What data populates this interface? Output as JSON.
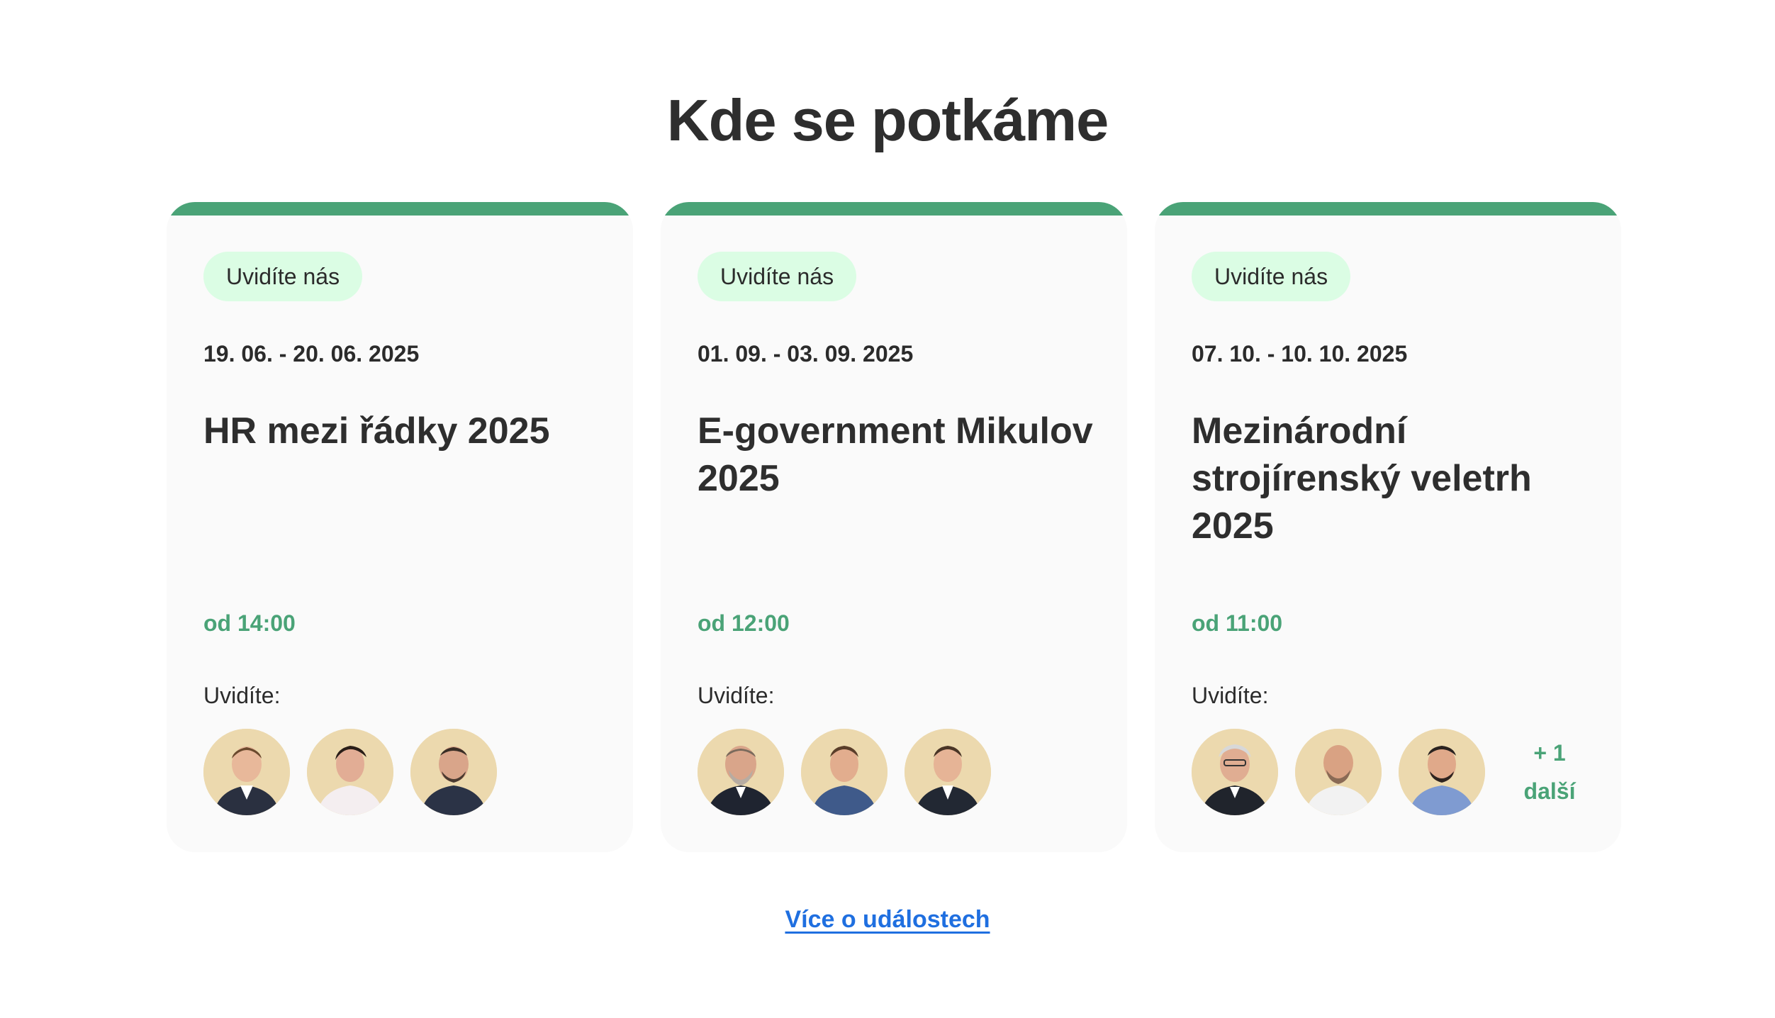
{
  "section": {
    "title": "Kde se potkáme",
    "more_link": "Více o událostech"
  },
  "colors": {
    "accent_green": "#4aa377",
    "badge_bg": "#dbfde4",
    "card_bg": "#fafafa",
    "link_blue": "#1f6fe0",
    "avatar_bg": "#ecd9ae"
  },
  "events": [
    {
      "badge": "Uvidíte nás",
      "date": "19. 06. - 20. 06. 2025",
      "title": "HR mezi řádky 2025",
      "time": "od 14:00",
      "see_label": "Uvidíte:",
      "avatars": [
        "person-photo",
        "person-photo",
        "person-photo"
      ]
    },
    {
      "badge": "Uvidíte nás",
      "date": "01. 09. - 03. 09. 2025",
      "title": "E-government Mikulov 2025",
      "time": "od 12:00",
      "see_label": "Uvidíte:",
      "avatars": [
        "person-photo",
        "person-photo",
        "person-photo"
      ]
    },
    {
      "badge": "Uvidíte nás",
      "date": "07. 10. - 10. 10. 2025",
      "title": "Mezinárodní strojírenský veletrh 2025",
      "time": "od 11:00",
      "see_label": "Uvidíte:",
      "avatars": [
        "person-photo",
        "person-photo",
        "person-photo"
      ],
      "more_count": "+ 1",
      "more_label": "další"
    }
  ]
}
